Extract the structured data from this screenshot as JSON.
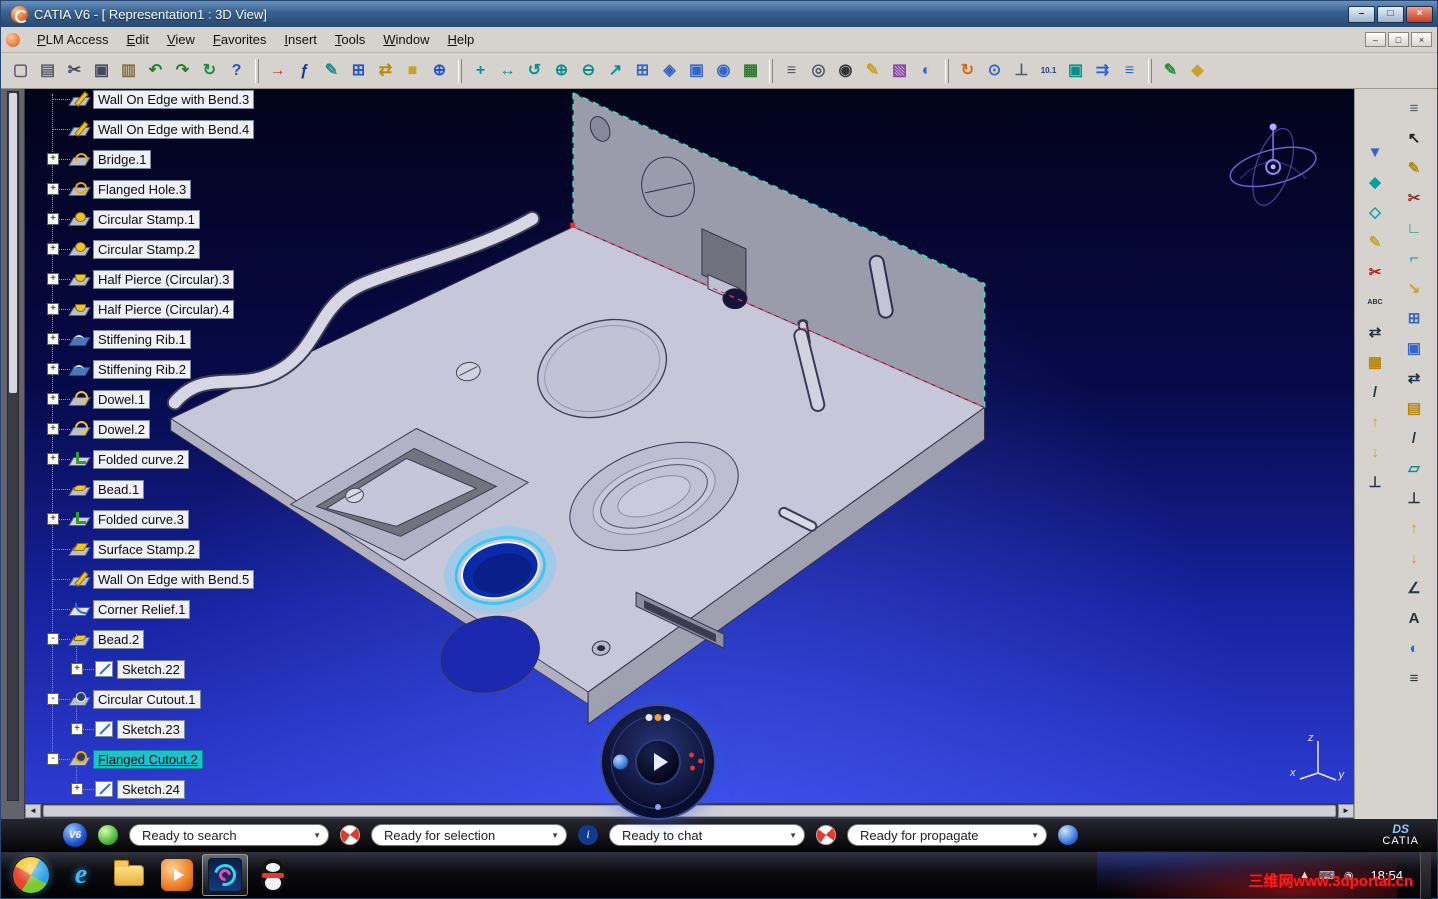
{
  "window": {
    "title": "CATIA V6 - [ Representation1 : 3D View]",
    "controls": {
      "minimize": "–",
      "maximize": "□",
      "close": "×"
    },
    "mdi_controls": {
      "minimize": "–",
      "restore": "□",
      "close": "×"
    }
  },
  "menubar": {
    "items": [
      "PLM Access",
      "Edit",
      "View",
      "Favorites",
      "Insert",
      "Tools",
      "Window",
      "Help"
    ]
  },
  "toolbar": {
    "items": [
      {
        "n": "new-document",
        "g": "▢",
        "c": "#5a5f74"
      },
      {
        "n": "print",
        "g": "▤",
        "c": "#5a5f74"
      },
      {
        "n": "cut",
        "g": "✂",
        "c": "#44485c"
      },
      {
        "n": "copy",
        "g": "▣",
        "c": "#44485c"
      },
      {
        "n": "paste",
        "g": "▥",
        "c": "#8a6d3b"
      },
      {
        "n": "undo",
        "g": "↶",
        "c": "#2b7a2b"
      },
      {
        "n": "redo",
        "g": "↷",
        "c": "#2b7a2b"
      },
      {
        "n": "update",
        "g": "↻",
        "c": "#1f8f3f"
      },
      {
        "n": "help",
        "g": "?",
        "c": "#2255cc"
      },
      {
        "sep": true
      },
      {
        "n": "fly-through",
        "g": "→",
        "c": "#cc3322"
      },
      {
        "n": "formula",
        "g": "ƒ",
        "c": "#223a8c"
      },
      {
        "n": "annotation",
        "g": "✎",
        "c": "#1f8f8f"
      },
      {
        "n": "window-layout",
        "g": "⊞",
        "c": "#2255cc"
      },
      {
        "n": "attach",
        "g": "⇄",
        "c": "#b8860b"
      },
      {
        "n": "lock",
        "g": "■",
        "c": "#c9a227"
      },
      {
        "n": "link",
        "g": "⊕",
        "c": "#2255cc"
      },
      {
        "sep": true
      },
      {
        "n": "fit-all",
        "g": "+",
        "c": "#0a8f8f"
      },
      {
        "n": "pan",
        "g": "↔",
        "c": "#0a8f8f"
      },
      {
        "n": "rotate",
        "g": "↺",
        "c": "#0a8f8f"
      },
      {
        "n": "zoom-in",
        "g": "⊕",
        "c": "#0a8f8f"
      },
      {
        "n": "zoom-out",
        "g": "⊖",
        "c": "#0a8f8f"
      },
      {
        "n": "normal-view",
        "g": "↗",
        "c": "#0a8f8f"
      },
      {
        "n": "multi-view",
        "g": "⊞",
        "c": "#3366cc"
      },
      {
        "n": "iso-view",
        "g": "◈",
        "c": "#3366cc"
      },
      {
        "n": "quick-view",
        "g": "▣",
        "c": "#3366cc"
      },
      {
        "n": "render-style",
        "g": "◉",
        "c": "#3366cc"
      },
      {
        "n": "capture",
        "g": "▦",
        "c": "#2b7a2b"
      },
      {
        "sep": true
      },
      {
        "n": "catalog",
        "g": "≡",
        "c": "#55586c"
      },
      {
        "n": "snap",
        "g": "◎",
        "c": "#55586c"
      },
      {
        "n": "camera",
        "g": "◉",
        "c": "#333333"
      },
      {
        "n": "paint",
        "g": "✎",
        "c": "#c9a227"
      },
      {
        "n": "material",
        "g": "▧",
        "c": "#8844aa"
      },
      {
        "n": "globe",
        "g": "◐",
        "c": "#3366cc"
      },
      {
        "sep": true
      },
      {
        "n": "refresh",
        "g": "↻",
        "c": "#d2691e"
      },
      {
        "n": "history",
        "g": "⊙",
        "c": "#3366cc"
      },
      {
        "n": "axis-system",
        "g": "⊥",
        "c": "#55586c"
      },
      {
        "n": "measure",
        "g": "10.1",
        "c": "#223a8c",
        "small": true
      },
      {
        "n": "update-parameters",
        "g": "▣",
        "c": "#0a8f8f"
      },
      {
        "n": "sequence",
        "g": "⇉",
        "c": "#3366cc"
      },
      {
        "n": "list-view",
        "g": "≡",
        "c": "#3366cc"
      },
      {
        "sep": true
      },
      {
        "n": "brush",
        "g": "✎",
        "c": "#1f8f3f"
      },
      {
        "n": "library",
        "g": "◆",
        "c": "#c9a227"
      }
    ]
  },
  "tree": {
    "items": [
      {
        "label": "Wall On Edge with Bend.3",
        "icon": "wall-bend",
        "exp": "",
        "level": 1,
        "selected": false
      },
      {
        "label": "Wall On Edge with Bend.4",
        "icon": "wall-bend",
        "exp": "",
        "level": 1,
        "selected": false
      },
      {
        "label": "Bridge.1",
        "icon": "bridge",
        "exp": "+",
        "level": 1,
        "selected": false
      },
      {
        "label": "Flanged Hole.3",
        "icon": "flanged-hole",
        "exp": "+",
        "level": 1,
        "selected": false
      },
      {
        "label": "Circular Stamp.1",
        "icon": "circular-stamp",
        "exp": "+",
        "level": 1,
        "selected": false
      },
      {
        "label": "Circular Stamp.2",
        "icon": "circular-stamp",
        "exp": "+",
        "level": 1,
        "selected": false
      },
      {
        "label": "Half Pierce (Circular).3",
        "icon": "half-pierce",
        "exp": "+",
        "level": 1,
        "selected": false
      },
      {
        "label": "Half Pierce (Circular).4",
        "icon": "half-pierce",
        "exp": "+",
        "level": 1,
        "selected": false
      },
      {
        "label": "Stiffening Rib.1",
        "icon": "stiffening-rib",
        "exp": "+",
        "level": 1,
        "selected": false
      },
      {
        "label": "Stiffening Rib.2",
        "icon": "stiffening-rib",
        "exp": "+",
        "level": 1,
        "selected": false
      },
      {
        "label": "Dowel.1",
        "icon": "dowel",
        "exp": "+",
        "level": 1,
        "selected": false
      },
      {
        "label": "Dowel.2",
        "icon": "dowel",
        "exp": "+",
        "level": 1,
        "selected": false
      },
      {
        "label": "Folded curve.2",
        "icon": "folded-curve",
        "exp": "+",
        "level": 1,
        "selected": false
      },
      {
        "label": "Bead.1",
        "icon": "bead",
        "exp": "",
        "level": 1,
        "selected": false
      },
      {
        "label": "Folded curve.3",
        "icon": "folded-curve",
        "exp": "+",
        "level": 1,
        "selected": false
      },
      {
        "label": "Surface Stamp.2",
        "icon": "surface-stamp",
        "exp": "",
        "level": 1,
        "selected": false
      },
      {
        "label": "Wall On Edge with Bend.5",
        "icon": "wall-bend",
        "exp": "",
        "level": 1,
        "selected": false
      },
      {
        "label": "Corner Relief.1",
        "icon": "corner-relief",
        "exp": "",
        "level": 1,
        "selected": false
      },
      {
        "label": "Bead.2",
        "icon": "bead",
        "exp": "-",
        "level": 1,
        "selected": false
      },
      {
        "label": "Sketch.22",
        "icon": "sketch",
        "exp": "+",
        "level": 2,
        "selected": false
      },
      {
        "label": "Circular Cutout.1",
        "icon": "circular-cutout",
        "exp": "-",
        "level": 1,
        "selected": false
      },
      {
        "label": "Sketch.23",
        "icon": "sketch",
        "exp": "+",
        "level": 2,
        "selected": false
      },
      {
        "label": "Flanged Cutout.2",
        "icon": "flanged-cutout",
        "exp": "-",
        "level": 1,
        "selected": true
      },
      {
        "label": "Sketch.24",
        "icon": "sketch",
        "exp": "+",
        "level": 2,
        "selected": false
      }
    ]
  },
  "right_toolbar": {
    "col1": [
      {
        "n": "filter",
        "g": "▼",
        "c": "#3366cc"
      },
      {
        "n": "view-gem",
        "g": "◆",
        "c": "#0aa0a0"
      },
      {
        "n": "section-gem",
        "g": "◇",
        "c": "#0aa0a0"
      },
      {
        "n": "pencil",
        "g": "✎",
        "c": "#c9a227"
      },
      {
        "n": "trim",
        "g": "✂",
        "c": "#b22222"
      },
      {
        "n": "spell-check",
        "g": "ABC",
        "c": "#223344",
        "small": true
      },
      {
        "n": "flip",
        "g": "⇄",
        "c": "#223344"
      },
      {
        "n": "stamp-pad",
        "g": "▦",
        "c": "#b8860b"
      },
      {
        "n": "diag-line",
        "g": "/",
        "c": "#223344"
      },
      {
        "n": "arrow-up",
        "g": "↑",
        "c": "#c9a227"
      },
      {
        "n": "arrow-down",
        "g": "↓",
        "c": "#c9a227"
      },
      {
        "n": "anchor",
        "g": "⊥",
        "c": "#223344"
      }
    ],
    "col2": [
      {
        "n": "panel-menu",
        "g": "≡",
        "c": "#55586c"
      },
      {
        "n": "select-cursor",
        "g": "↖",
        "c": "#222222"
      },
      {
        "n": "sketch-edit",
        "g": "✎",
        "c": "#b8860b"
      },
      {
        "n": "knife",
        "g": "✂",
        "c": "#8a3333"
      },
      {
        "n": "wall-tool",
        "g": "∟",
        "c": "#0a8f8f"
      },
      {
        "n": "bend-tool",
        "g": "⌐",
        "c": "#0a8f8f"
      },
      {
        "n": "unfold",
        "g": "↘",
        "c": "#c9a227"
      },
      {
        "n": "pattern",
        "g": "⊞",
        "c": "#3366cc"
      },
      {
        "n": "box-mode",
        "g": "▣",
        "c": "#3366cc"
      },
      {
        "n": "swap-view",
        "g": "⇄",
        "c": "#223344"
      },
      {
        "n": "stamp-tool",
        "g": "▤",
        "c": "#b8860b"
      },
      {
        "n": "line-tool",
        "g": "/",
        "c": "#223344"
      },
      {
        "n": "plane-tool",
        "g": "▱",
        "c": "#0a8f8f"
      },
      {
        "n": "axis-tool",
        "g": "⊥",
        "c": "#223344"
      },
      {
        "n": "fold-up",
        "g": "↑",
        "c": "#c9a227"
      },
      {
        "n": "fold-down",
        "g": "↓",
        "c": "#c9a227"
      },
      {
        "n": "angle-measure",
        "g": "∠",
        "c": "#223344"
      },
      {
        "n": "text-note",
        "g": "A",
        "c": "#223344"
      },
      {
        "n": "half-tone",
        "g": "◐",
        "c": "#3366cc"
      },
      {
        "n": "ground",
        "g": "≡",
        "c": "#223344"
      }
    ]
  },
  "viewport": {
    "axis_labels": {
      "z": "z",
      "x": "x",
      "y": "y"
    }
  },
  "statusbar": {
    "v6": "V6",
    "info_glyph": "i",
    "fields": [
      {
        "value": "Ready to search"
      },
      {
        "value": "Ready for selection"
      },
      {
        "value": "Ready to chat"
      },
      {
        "value": "Ready for propagate"
      }
    ],
    "chevron": "▼",
    "brand_mark": "DS",
    "brand": "CATIA"
  },
  "taskbar": {
    "ie_glyph": "e",
    "time": "18:54",
    "tray_icons": [
      {
        "name": "tray-expand",
        "glyph": "▲"
      },
      {
        "name": "tray-input",
        "glyph": "⌨"
      },
      {
        "name": "tray-message",
        "glyph": "◉"
      }
    ]
  },
  "watermark": "三维网www.3dportal.cn",
  "colors": {
    "accent_selection": "#19c3c9",
    "highlight_hole": "#35c8f5",
    "viewport_top": "#03031a",
    "viewport_bottom": "#2c3cd2"
  }
}
